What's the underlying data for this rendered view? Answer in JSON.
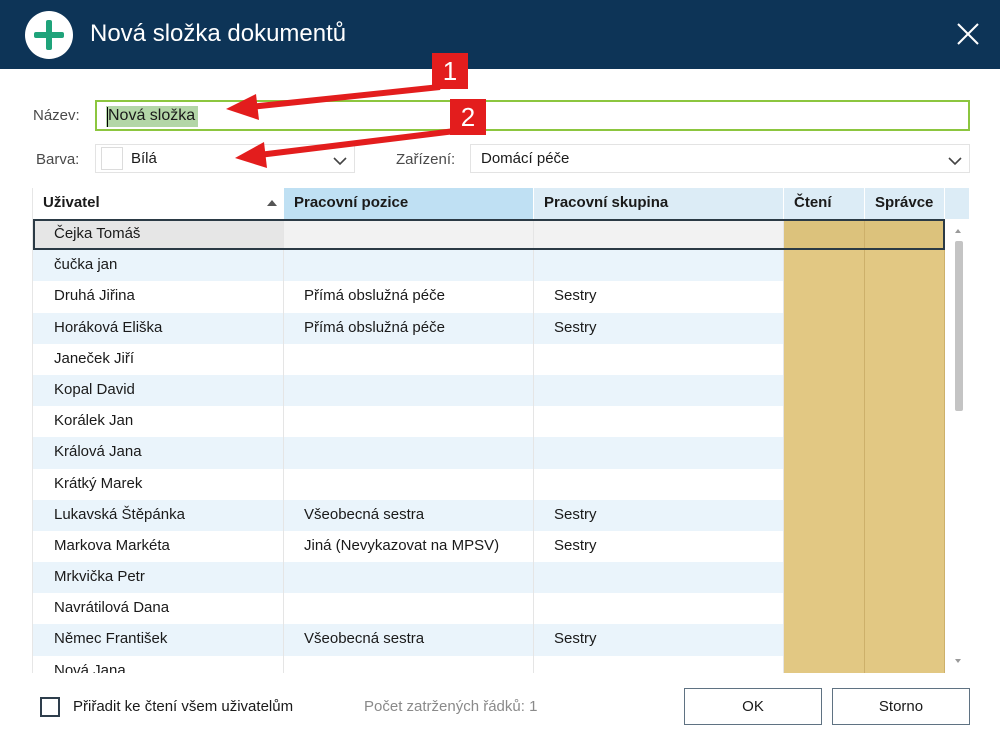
{
  "window": {
    "title": "Nová složka dokumentů"
  },
  "form": {
    "name_label": "Název:",
    "name_value": "Nová složka",
    "color_label": "Barva:",
    "color_value": "Bílá",
    "device_label": "Zařízení:",
    "device_value": "Domácí péče"
  },
  "table": {
    "columns": [
      "Uživatel",
      "Pracovní pozice",
      "Pracovní skupina",
      "Čtení",
      "Správce"
    ],
    "rows": [
      {
        "user": "Čejka Tomáš",
        "position": "",
        "group": ""
      },
      {
        "user": "čučka jan",
        "position": "",
        "group": ""
      },
      {
        "user": "Druhá Jiřina",
        "position": "Přímá obslužná péče",
        "group": "Sestry"
      },
      {
        "user": "Horáková Eliška",
        "position": "Přímá obslužná péče",
        "group": "Sestry"
      },
      {
        "user": "Janeček Jiří",
        "position": "",
        "group": ""
      },
      {
        "user": "Kopal David",
        "position": "",
        "group": ""
      },
      {
        "user": "Korálek Jan",
        "position": "",
        "group": ""
      },
      {
        "user": "Králová Jana",
        "position": "",
        "group": ""
      },
      {
        "user": "Krátký Marek",
        "position": "",
        "group": ""
      },
      {
        "user": "Lukavská Štěpánka",
        "position": "Všeobecná sestra",
        "group": "Sestry"
      },
      {
        "user": "Markova Markéta",
        "position": "Jiná (Nevykazovat na MPSV)",
        "group": "Sestry"
      },
      {
        "user": "Mrkvička Petr",
        "position": "",
        "group": ""
      },
      {
        "user": "Navrátilová Dana",
        "position": "",
        "group": ""
      },
      {
        "user": "Němec František",
        "position": "Všeobecná sestra",
        "group": "Sestry"
      },
      {
        "user": "Nová Jana",
        "position": "",
        "group": ""
      }
    ]
  },
  "footer": {
    "assign_all_label": "Přiřadit ke čtení všem uživatelům",
    "assign_all_checked": false,
    "checked_rows_label": "Počet zatržených řádků: 1",
    "ok_label": "OK",
    "cancel_label": "Storno"
  },
  "annotations": {
    "marker1": "1",
    "marker2": "2"
  },
  "colors": {
    "titlebar": "#0d3457",
    "accent_green": "#1fa37a",
    "input_border": "#8cc63f",
    "header_bg": "#dcecf6",
    "row_alt": "#eaf4fb",
    "permission_cell": "#e2c883",
    "marker_red": "#e31d1d"
  },
  "icons": {
    "title": "plus-circle-icon",
    "close": "close-icon",
    "dropdown": "chevron-down-icon",
    "sort": "sort-ascending-icon"
  }
}
